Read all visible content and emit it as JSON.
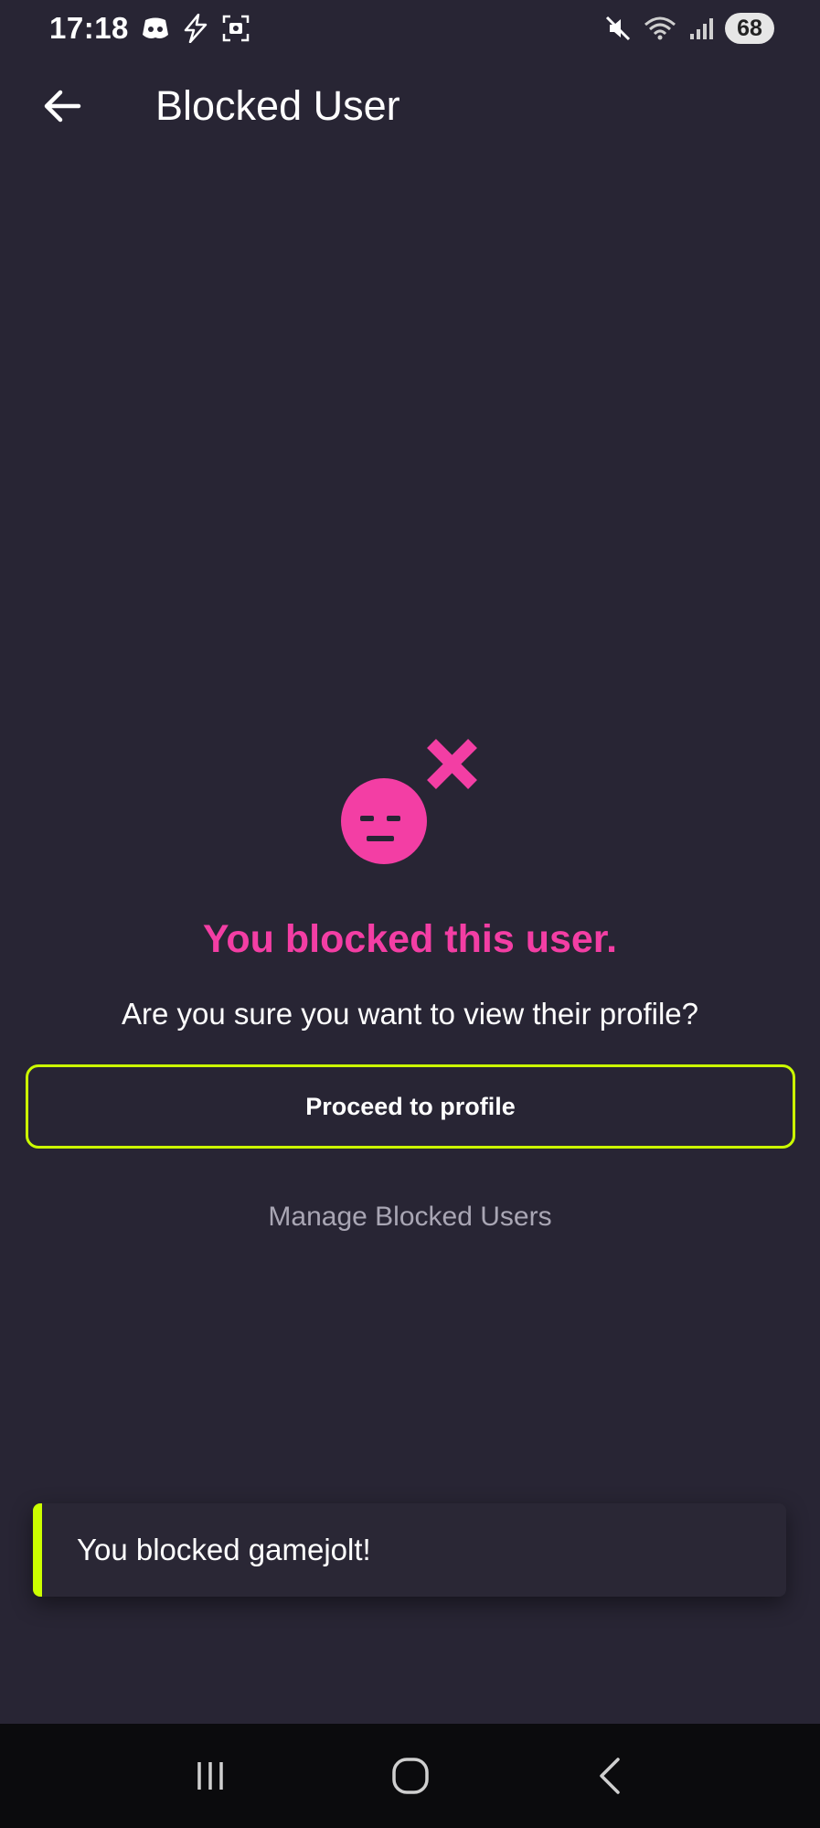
{
  "status_bar": {
    "time": "17:18",
    "left_icons": [
      "discord-icon",
      "bolt-icon",
      "screenshot-icon"
    ],
    "right_icons": [
      "mute-icon",
      "wifi-icon",
      "signal-icon"
    ],
    "battery": "68"
  },
  "app_bar": {
    "back_icon": "arrow-left-icon",
    "title": "Blocked User"
  },
  "content": {
    "icon": "blocked-face-icon",
    "heading": "You blocked this user.",
    "question": "Are you sure you want to view their profile?",
    "proceed_label": "Proceed to profile",
    "manage_label": "Manage Blocked Users"
  },
  "toast": {
    "message": "You blocked gamejolt!"
  },
  "nav_bar": {
    "recents_icon": "recents-icon",
    "home_icon": "home-icon",
    "back_icon": "back-chevron-icon"
  },
  "colors": {
    "background": "#282534",
    "accent_pink": "#f33ea4",
    "accent_lime": "#ccff00",
    "muted_text": "#a9a6b4"
  }
}
